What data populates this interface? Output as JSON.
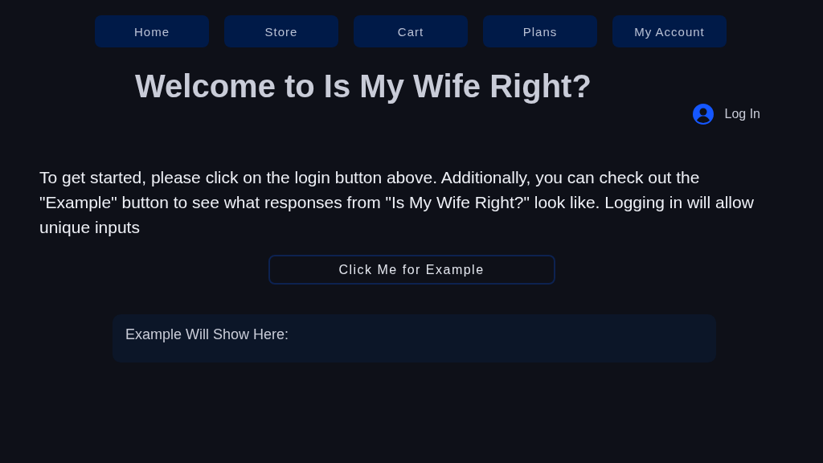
{
  "nav": [
    {
      "label": "Home"
    },
    {
      "label": "Store"
    },
    {
      "label": "Cart"
    },
    {
      "label": "Plans"
    },
    {
      "label": "My Account"
    }
  ],
  "title": "Welcome to Is My Wife Right?",
  "login": {
    "label": "Log In"
  },
  "intro": "To get started, please click on the login button above. Additionally, you can check out the \"Example\" button to see what responses from \"Is My Wife Right?\" look like. Logging in will allow unique inputs",
  "example_button": "Click Me for Example",
  "example_box": {
    "text": "Example Will Show Here:"
  }
}
